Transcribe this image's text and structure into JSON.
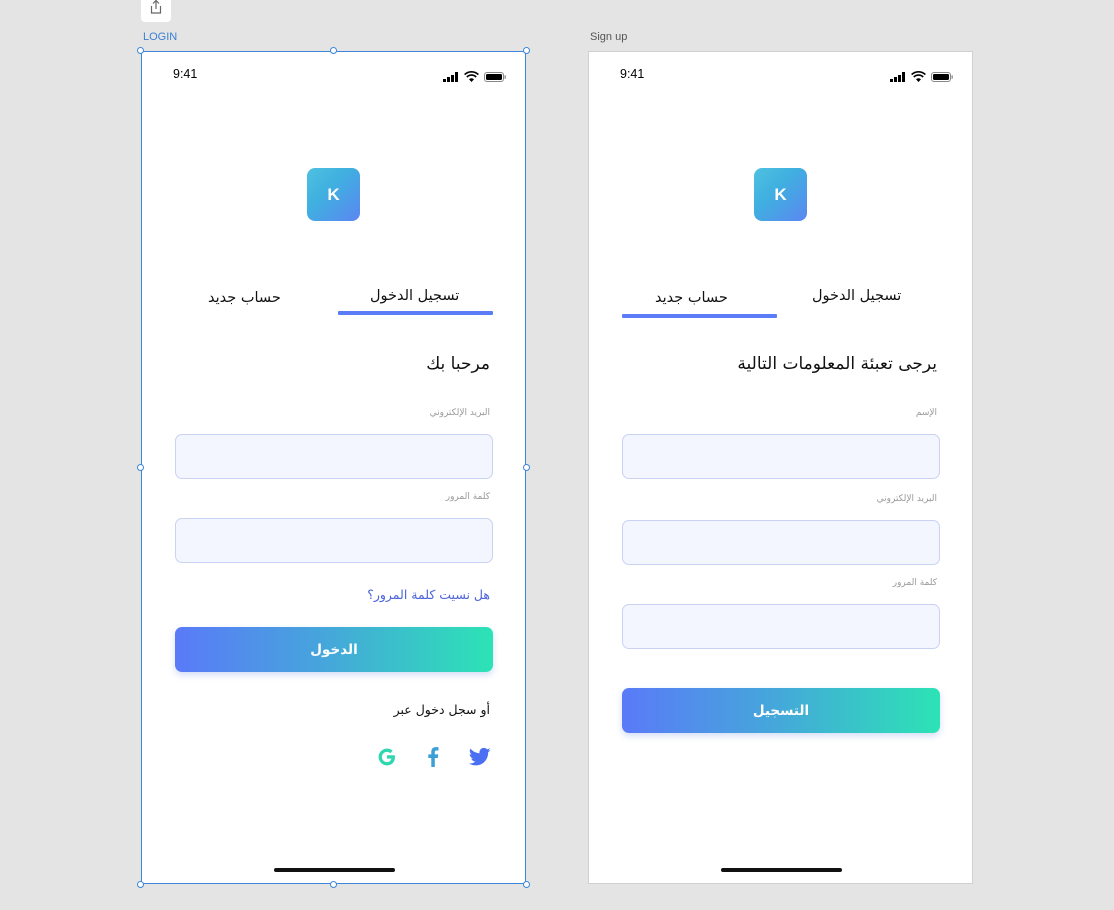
{
  "artboards": {
    "login_label": "LOGIN",
    "signup_label": "Sign up"
  },
  "login": {
    "status_time": "9:41",
    "logo_letter": "K",
    "tabs": {
      "login": "تسجيل الدخول",
      "signup": "حساب جديد",
      "active": "login"
    },
    "heading": "مرحبا بك",
    "fields": {
      "email_label": "البريد الإلكتروني",
      "email_value": "",
      "password_label": "كلمة المرور",
      "password_value": ""
    },
    "forgot_password": "هل نسيت كلمة المرور؟",
    "submit_label": "الدخول",
    "social_prompt": "أو سجل دخول عبر",
    "social_icons": [
      "twitter-icon",
      "facebook-icon",
      "google-icon"
    ]
  },
  "signup": {
    "status_time": "9:41",
    "logo_letter": "K",
    "tabs": {
      "login": "تسجيل الدخول",
      "signup": "حساب جديد",
      "active": "signup"
    },
    "heading": "يرجى تعبئة المعلومات التالية",
    "fields": {
      "name_label": "الإسم",
      "name_value": "",
      "email_label": "البريد الإلكتروني",
      "email_value": "",
      "password_label": "كلمة المرور",
      "password_value": ""
    },
    "submit_label": "التسجيل"
  },
  "colors": {
    "accent": "#5b7cf6",
    "link": "#4a63d8",
    "gradient_start": "#5a7af8",
    "gradient_end": "#2ce3b5",
    "input_bg": "#f3f6ff",
    "input_border": "#c9d2f3",
    "twitter": "#4a6ff2",
    "facebook": "#3aa0d6",
    "google": "#2fd7b0"
  }
}
